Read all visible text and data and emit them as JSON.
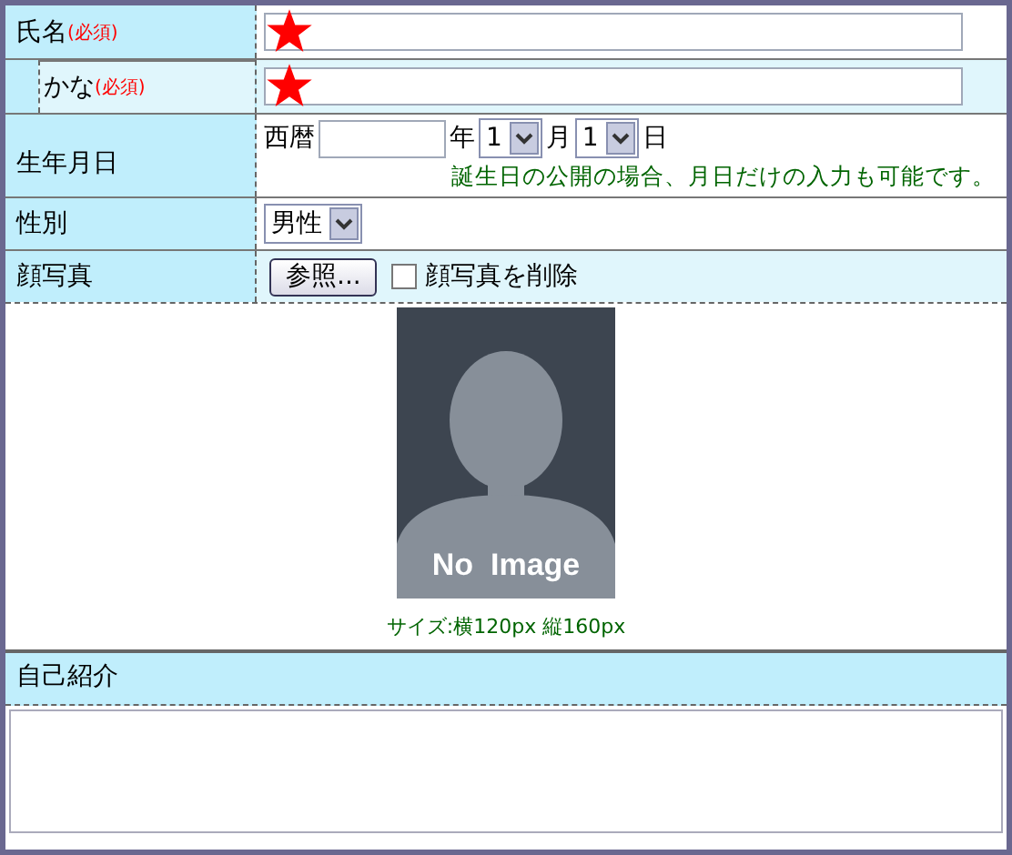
{
  "name_fields": [
    {
      "label": "氏名",
      "required_note": "(必須)",
      "required": true,
      "indented": false
    },
    {
      "label": "かな",
      "required_note": "(必須)",
      "required": true,
      "indented": true
    }
  ],
  "birthday": {
    "label": "生年月日",
    "era": "西暦",
    "year_unit": "年",
    "month": "1",
    "month_unit": "月",
    "day": "1",
    "day_unit": "日",
    "note": "誕生日の公開の場合、月日だけの入力も可能です。"
  },
  "gender": {
    "label": "性別",
    "value": "男性"
  },
  "photo": {
    "label": "顔写真",
    "browse_button": "参照...",
    "delete_label": "顔写真を削除",
    "delete_checked": false,
    "placeholder_text": "No  Image",
    "size_note": "サイズ:横120px 縦160px"
  },
  "intro": {
    "label": "自己紹介"
  }
}
